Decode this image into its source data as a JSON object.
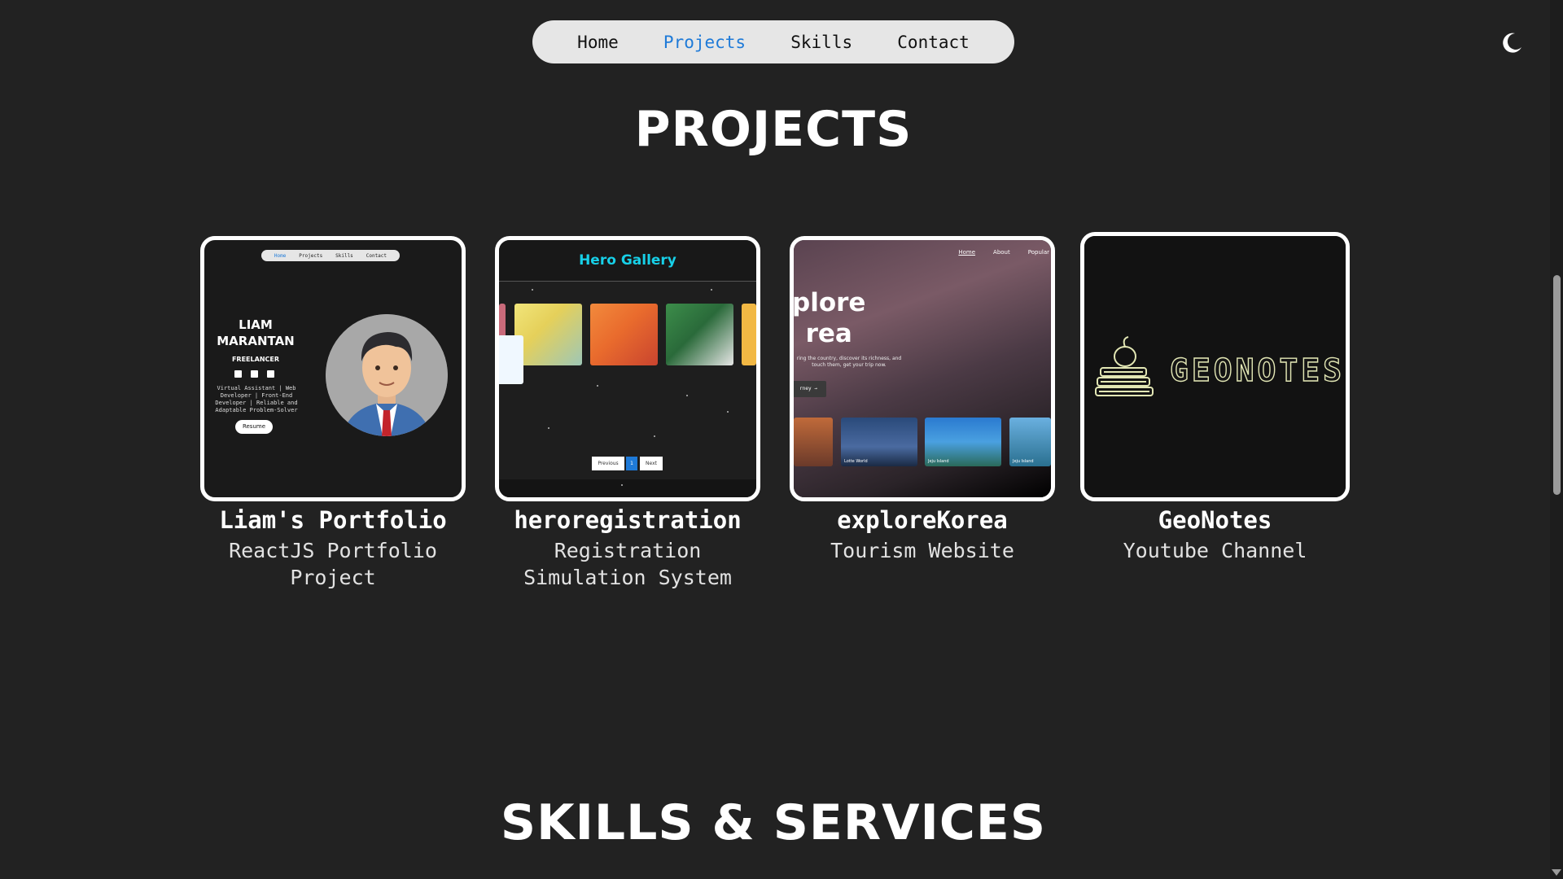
{
  "nav": {
    "items": [
      "Home",
      "Projects",
      "Skills",
      "Contact"
    ],
    "active": "Projects",
    "theme_icon": "moon-icon"
  },
  "sections": {
    "projects_title": "PROJECTS",
    "skills_title": "SKILLS & SERVICES"
  },
  "projects": [
    {
      "title": "Liam's Portfolio",
      "description": "ReactJS Portfolio Project",
      "thumbnail": {
        "nav": [
          "Home",
          "Projects",
          "Skills",
          "Contact"
        ],
        "name": "LIAM MARANTAN",
        "role": "FREELANCER",
        "bio": "Virtual Assistant | Web Developer | Front-End Developer | Reliable and Adaptable Problem-Solver",
        "button": "Resume"
      }
    },
    {
      "title": "heroregistration",
      "description": "Registration Simulation System",
      "thumbnail": {
        "header": "Hero Gallery",
        "pagination": [
          "Previous",
          "1",
          "Next"
        ]
      }
    },
    {
      "title": "exploreKorea",
      "description": "Tourism Website",
      "thumbnail": {
        "nav": [
          "Home",
          "About",
          "Popular"
        ],
        "hero": "plore\nrea",
        "subtext": "ring the country, discover its richness, and touch them, get your trip now.",
        "button": "rney →",
        "tiles": [
          "",
          "Lotte World",
          "Jeju Island",
          "Jeju Island"
        ]
      }
    },
    {
      "title": "GeoNotes",
      "description": "Youtube Channel",
      "thumbnail": {
        "logo_text": "GEONOTES"
      }
    }
  ],
  "colors": {
    "background": "#222222",
    "nav_bg": "#e6e6e6",
    "accent": "#1e7ad8",
    "hero_gallery": "#17d0e8"
  }
}
